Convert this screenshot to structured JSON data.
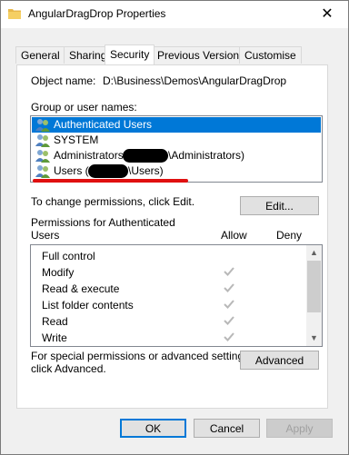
{
  "window": {
    "title": "AngularDragDrop Properties",
    "close_glyph": "✕"
  },
  "tabs": [
    {
      "label": "General"
    },
    {
      "label": "Sharing"
    },
    {
      "label": "Security",
      "active": true
    },
    {
      "label": "Previous Versions"
    },
    {
      "label": "Customise"
    }
  ],
  "security": {
    "object_name_label": "Object name:",
    "object_name_value": "D:\\Business\\Demos\\AngularDragDrop",
    "group_label": "Group or user names:",
    "users": [
      {
        "text": "Authenticated Users",
        "selected": true,
        "icon": "user-group-icon"
      },
      {
        "text": "SYSTEM",
        "selected": false,
        "icon": "user-group-icon"
      },
      {
        "text_prefix": "Administrators (",
        "text_suffix": "\\Administrators)",
        "icon": "user-group-icon"
      },
      {
        "text_prefix": "Users (",
        "text_suffix": "\\Users)",
        "icon": "user-group-icon"
      }
    ],
    "change_text": "To change permissions, click Edit.",
    "edit_button": "Edit...",
    "permissions_label_line1": "Permissions for Authenticated",
    "permissions_label_line2": "Users",
    "allow_label": "Allow",
    "deny_label": "Deny",
    "permissions": [
      {
        "name": "Full control",
        "allow": false,
        "deny": false
      },
      {
        "name": "Modify",
        "allow": true,
        "deny": false
      },
      {
        "name": "Read & execute",
        "allow": true,
        "deny": false
      },
      {
        "name": "List folder contents",
        "allow": true,
        "deny": false
      },
      {
        "name": "Read",
        "allow": true,
        "deny": false
      },
      {
        "name": "Write",
        "allow": true,
        "deny": false
      }
    ],
    "special_line1": "For special permissions or advanced settings,",
    "special_line2": "click Advanced.",
    "advanced_button": "Advanced"
  },
  "footer": {
    "ok": "OK",
    "cancel": "Cancel",
    "apply": "Apply"
  },
  "colors": {
    "selection": "#0078d7",
    "redaction": "#000000",
    "underline": "#e01010",
    "check": "#b8b8b8"
  }
}
